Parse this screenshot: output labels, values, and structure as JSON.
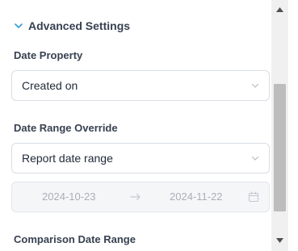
{
  "section": {
    "title": "Advanced Settings",
    "icon": "chevron-down-icon",
    "accent": "#2f9ed6"
  },
  "date_property": {
    "label": "Date Property",
    "value": "Created on"
  },
  "date_range_override": {
    "label": "Date Range Override",
    "value": "Report date range"
  },
  "date_range": {
    "start": "2024-10-23",
    "end": "2024-11-22"
  },
  "comparison": {
    "label": "Comparison Date Range"
  }
}
